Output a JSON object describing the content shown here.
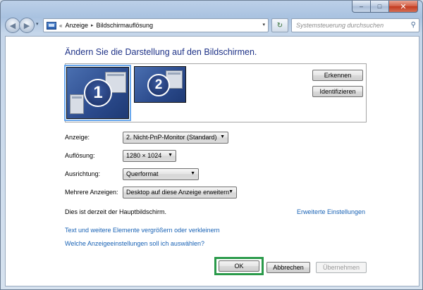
{
  "titlebar": {
    "min_icon": "minimize-icon",
    "max_icon": "maximize-icon",
    "close_icon": "close-icon",
    "min_glyph": "–",
    "max_glyph": "□",
    "close_glyph": "✕"
  },
  "navbar": {
    "back_glyph": "◀",
    "forward_glyph": "▶",
    "history_glyph": "▾",
    "breadcrumb_prefix": "«",
    "breadcrumb": [
      "Anzeige",
      "Bildschirmauflösung"
    ],
    "breadcrumb_sep": "▸",
    "refresh_glyph": "↻",
    "search_placeholder": "Systemsteuerung durchsuchen",
    "search_glyph": "⚲"
  },
  "page": {
    "title": "Ändern Sie die Darstellung auf den Bildschirmen."
  },
  "monitors": {
    "monitor1_number": "1",
    "monitor2_number": "2",
    "detect_button": "Erkennen",
    "identify_button": "Identifizieren"
  },
  "settings": {
    "display_label": "Anzeige:",
    "display_value": "2. Nicht-PnP-Monitor (Standard)",
    "resolution_label": "Auflösung:",
    "resolution_value": "1280 × 1024",
    "orientation_label": "Ausrichtung:",
    "orientation_value": "Querformat",
    "multiple_label": "Mehrere Anzeigen:",
    "multiple_value": "Desktop auf diese Anzeige erweitern",
    "dropdown_glyph": "▼"
  },
  "info": {
    "main_display_text": "Dies ist derzeit der Hauptbildschirm.",
    "advanced_link": "Erweiterte Einstellungen",
    "text_size_link": "Text und weitere Elemente vergrößern oder verkleinern",
    "which_settings_link": "Welche Anzeigeeinstellungen soll ich auswählen?"
  },
  "footer": {
    "ok": "OK",
    "cancel": "Abbrechen",
    "apply": "Übernehmen"
  },
  "colors": {
    "title_blue": "#1e3287",
    "link_blue": "#1862b5",
    "highlight_green": "#2a9a4a",
    "monitor_blue": "#2b4a8c"
  }
}
